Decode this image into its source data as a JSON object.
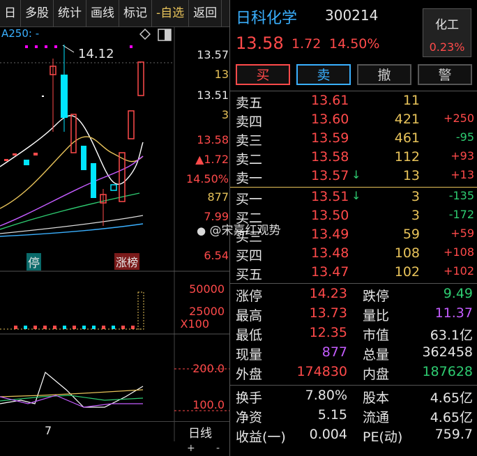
{
  "toolbar": {
    "items": [
      "日",
      "多股",
      "统计",
      "画线",
      "标记",
      "-自选",
      "返回"
    ]
  },
  "chart": {
    "ma_label": "A250: -",
    "high_marker": "14.12",
    "axis_labels": {
      "p1": "13.57",
      "p2": "13",
      "p3": "13.51",
      "p4": "3",
      "p5": "13.58",
      "p6": "▲1.72",
      "p7": "14.50%",
      "p8": "877",
      "p9": "7.99",
      "p10": "6.54"
    },
    "tag_stop": "停",
    "tag_limit": "涨榜",
    "volume_axis": {
      "v1": "50000",
      "v2": "25000",
      "unit": "X100"
    },
    "indicator_axis": {
      "i1": "200.0",
      "i2": "100.0"
    },
    "date_label": "7",
    "period": "日线",
    "zoom_plus": "+",
    "zoom_minus": "-"
  },
  "quote": {
    "name": "日科化学",
    "code": "300214",
    "price": "13.58",
    "change": "1.72",
    "change_pct": "14.50%",
    "sector": "化工",
    "sector_pct": "0.23%"
  },
  "trade_buttons": {
    "buy": "买",
    "sell": "卖",
    "cancel": "撤",
    "alert": "警"
  },
  "order_book": {
    "asks": [
      {
        "label": "卖五",
        "price": "13.61",
        "vol": "11",
        "chg": ""
      },
      {
        "label": "卖四",
        "price": "13.60",
        "vol": "421",
        "chg": "+250"
      },
      {
        "label": "卖三",
        "price": "13.59",
        "vol": "461",
        "chg": "-95"
      },
      {
        "label": "卖二",
        "price": "13.58",
        "vol": "112",
        "chg": "+93"
      },
      {
        "label": "卖一",
        "price": "13.57",
        "vol": "13",
        "chg": "+13"
      }
    ],
    "bids": [
      {
        "label": "买一",
        "price": "13.51",
        "vol": "3",
        "chg": "-135"
      },
      {
        "label": "买二",
        "price": "13.50",
        "vol": "3",
        "chg": "-172"
      },
      {
        "label": "买三",
        "price": "13.49",
        "vol": "59",
        "chg": "+59"
      },
      {
        "label": "买四",
        "price": "13.48",
        "vol": "108",
        "chg": "+108"
      },
      {
        "label": "买五",
        "price": "13.47",
        "vol": "102",
        "chg": "+102"
      }
    ]
  },
  "watermark": "@宋嘉红观势",
  "stats": [
    {
      "l1": "涨停",
      "v1": "14.23",
      "l2": "跌停",
      "v2": "9.49"
    },
    {
      "l1": "最高",
      "v1": "13.73",
      "l2": "量比",
      "v2": "11.37"
    },
    {
      "l1": "最低",
      "v1": "12.35",
      "l2": "市值",
      "v2": "63.1亿"
    },
    {
      "l1": "现量",
      "v1": "877",
      "l2": "总量",
      "v2": "362458"
    },
    {
      "l1": "外盘",
      "v1": "174830",
      "l2": "内盘",
      "v2": "187628"
    }
  ],
  "stats2": [
    {
      "l1": "换手",
      "v1": "7.80%",
      "l2": "股本",
      "v2": "4.65亿"
    },
    {
      "l1": "净资",
      "v1": "5.15",
      "l2": "流通",
      "v2": "4.65亿"
    },
    {
      "l1": "收益(一)",
      "v1": "0.004",
      "l2": "PE(动)",
      "v2": "759.7"
    }
  ],
  "colors": {
    "up": "#ff4a4a",
    "down": "#2ecc71",
    "accent": "#3ab0ff"
  }
}
